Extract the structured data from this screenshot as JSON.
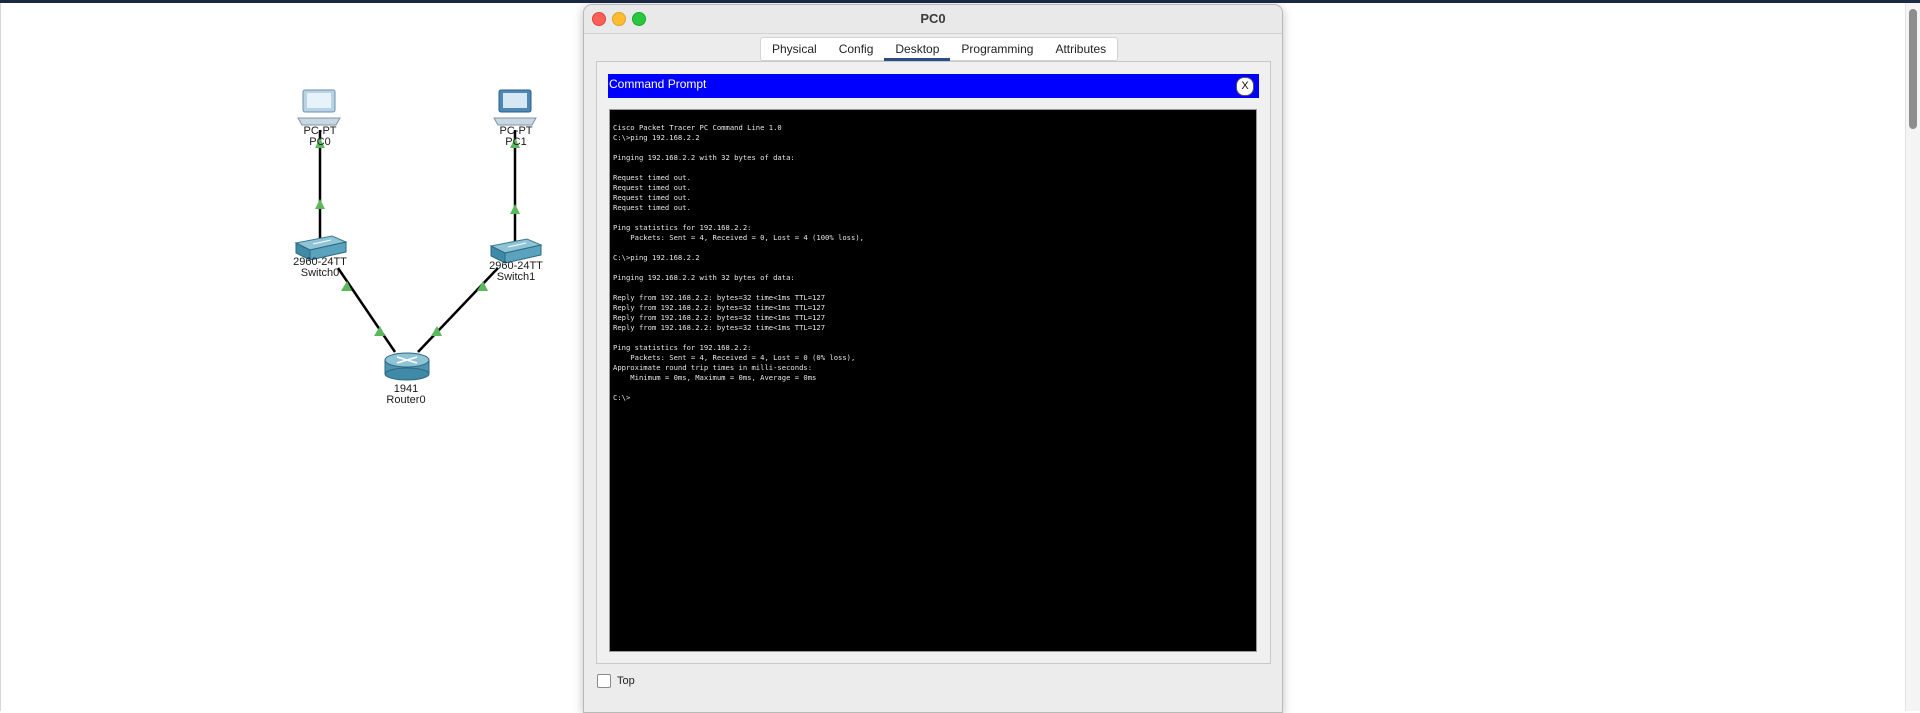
{
  "window": {
    "title": "PC0"
  },
  "tabs": [
    {
      "label": "Physical",
      "active": false
    },
    {
      "label": "Config",
      "active": false
    },
    {
      "label": "Desktop",
      "active": true
    },
    {
      "label": "Programming",
      "active": false
    },
    {
      "label": "Attributes",
      "active": false
    }
  ],
  "command_prompt": {
    "title": "Command Prompt",
    "close_label": "X",
    "lines": [
      "Cisco Packet Tracer PC Command Line 1.0",
      "C:\\>ping 192.168.2.2",
      "",
      "Pinging 192.168.2.2 with 32 bytes of data:",
      "",
      "Request timed out.",
      "Request timed out.",
      "Request timed out.",
      "Request timed out.",
      "",
      "Ping statistics for 192.168.2.2:",
      "    Packets: Sent = 4, Received = 0, Lost = 4 (100% loss),",
      "",
      "C:\\>ping 192.168.2.2",
      "",
      "Pinging 192.168.2.2 with 32 bytes of data:",
      "",
      "Reply from 192.168.2.2: bytes=32 time<1ms TTL=127",
      "Reply from 192.168.2.2: bytes=32 time<1ms TTL=127",
      "Reply from 192.168.2.2: bytes=32 time<1ms TTL=127",
      "Reply from 192.168.2.2: bytes=32 time<1ms TTL=127",
      "",
      "Ping statistics for 192.168.2.2:",
      "    Packets: Sent = 4, Received = 4, Lost = 0 (0% loss),",
      "Approximate round trip times in milli-seconds:",
      "    Minimum = 0ms, Maximum = 0ms, Average = 0ms",
      "",
      "C:\\>"
    ]
  },
  "footer": {
    "top_label": "Top",
    "top_checked": false
  },
  "topology": {
    "pc0": {
      "model": "PC-PT",
      "name": "PC0"
    },
    "pc1": {
      "model": "PC-PT",
      "name": "PC1"
    },
    "switch0": {
      "model": "2960-24TT",
      "name": "Switch0"
    },
    "switch1": {
      "model": "2960-24TT",
      "name": "Switch1"
    },
    "router0": {
      "model": "1941",
      "name": "Router0"
    },
    "link_color": "#5cb85c"
  }
}
